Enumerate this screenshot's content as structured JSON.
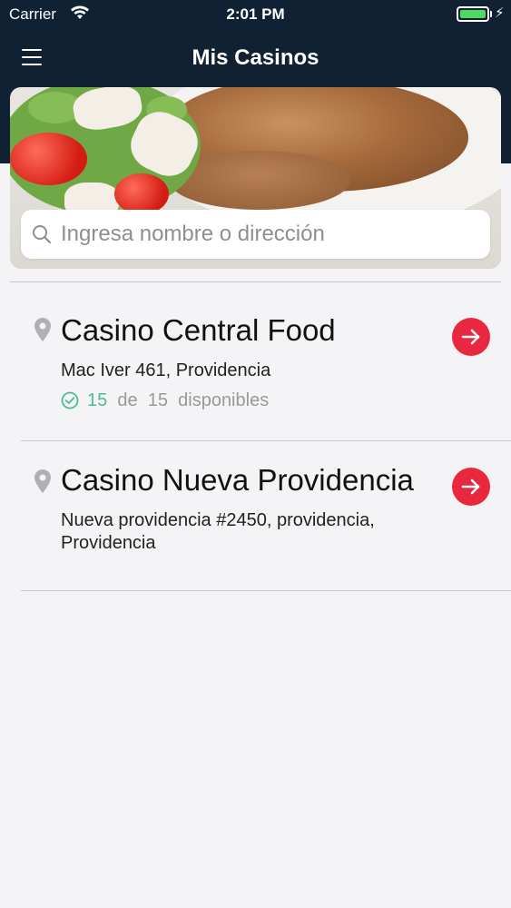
{
  "status_bar": {
    "carrier": "Carrier",
    "time": "2:01 PM",
    "battery_level": 1.0
  },
  "nav": {
    "title": "Mis Casinos",
    "menu_icon": "hamburger-menu-icon"
  },
  "search": {
    "placeholder": "Ingresa nombre o dirección",
    "value": ""
  },
  "casinos": [
    {
      "name": "Casino Central Food",
      "address": "Mac Iver 461, Providencia",
      "available": "15",
      "of": "de",
      "total": "15",
      "available_label": "disponibles"
    },
    {
      "name": "Casino Nueva Providencia",
      "address": "Nueva providencia #2450, providencia, Providencia"
    }
  ],
  "colors": {
    "header_bg": "#0f2133",
    "accent_red": "#e8283f",
    "available_green": "#4cbd8f",
    "battery_green": "#4cd964"
  },
  "icons": [
    "wifi-icon",
    "battery-icon",
    "search-icon",
    "location-pin-icon",
    "arrow-right-icon",
    "check-circle-icon"
  ]
}
